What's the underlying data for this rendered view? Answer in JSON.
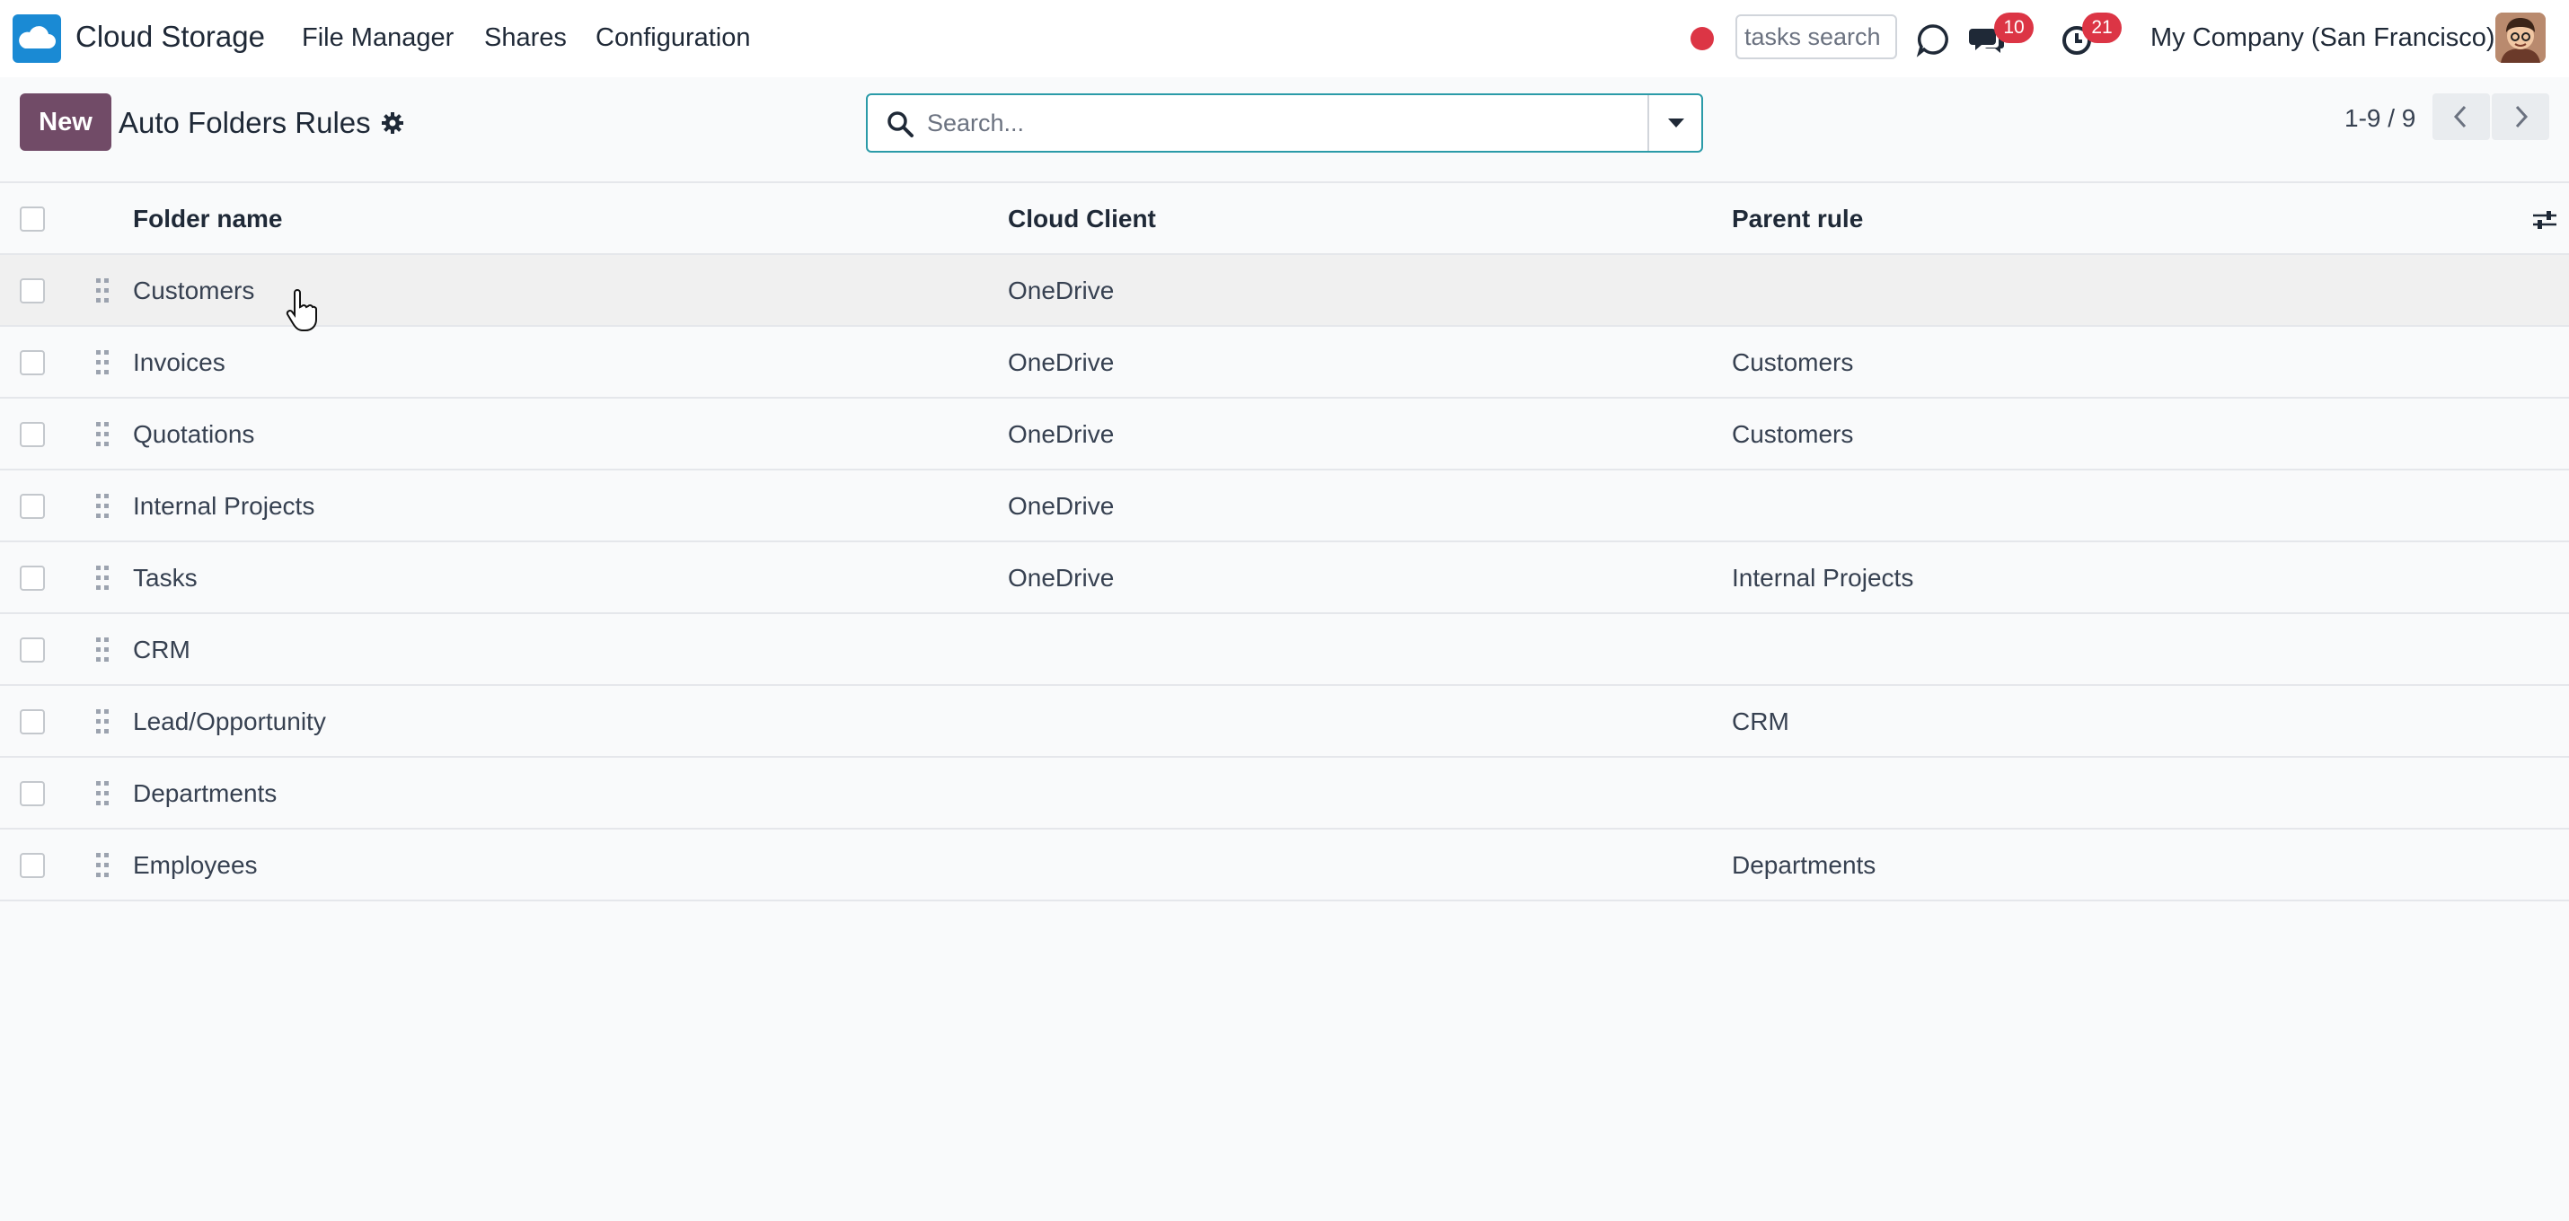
{
  "navbar": {
    "app_name": "Cloud Storage",
    "menu": [
      "File Manager",
      "Shares",
      "Configuration"
    ],
    "tasks_search_placeholder": "tasks search",
    "messages_count": "10",
    "activities_count": "21",
    "company": "My Company (San Francisco)"
  },
  "control_panel": {
    "new_label": "New",
    "title": "Auto Folders Rules",
    "search_placeholder": "Search...",
    "pager": "1-9 / 9"
  },
  "table": {
    "headers": {
      "name": "Folder name",
      "client": "Cloud Client",
      "parent": "Parent rule"
    },
    "rows": [
      {
        "name": "Customers",
        "client": "OneDrive",
        "parent": ""
      },
      {
        "name": "Invoices",
        "client": "OneDrive",
        "parent": "Customers"
      },
      {
        "name": "Quotations",
        "client": "OneDrive",
        "parent": "Customers"
      },
      {
        "name": "Internal Projects",
        "client": "OneDrive",
        "parent": ""
      },
      {
        "name": "Tasks",
        "client": "OneDrive",
        "parent": "Internal Projects"
      },
      {
        "name": "CRM",
        "client": "",
        "parent": ""
      },
      {
        "name": "Lead/Opportunity",
        "client": "",
        "parent": "CRM"
      },
      {
        "name": "Departments",
        "client": "",
        "parent": ""
      },
      {
        "name": "Employees",
        "client": "",
        "parent": "Departments"
      }
    ]
  },
  "colors": {
    "primary": "#714b67",
    "badge": "#dc3545",
    "search_border": "#2b9ba8",
    "logo": "#1a8ad4"
  },
  "icons": {
    "logo": "cloud-logo-icon",
    "recording": "record-dot-icon",
    "phone": "voip-phone-icon",
    "messages": "chat-bubbles-icon",
    "activities": "clock-icon",
    "settings": "gear-icon",
    "search": "search-icon",
    "dropdown": "caret-down-icon",
    "prev": "chevron-left-icon",
    "next": "chevron-right-icon",
    "optional_columns": "sliders-icon",
    "drag": "drag-handle-icon"
  }
}
